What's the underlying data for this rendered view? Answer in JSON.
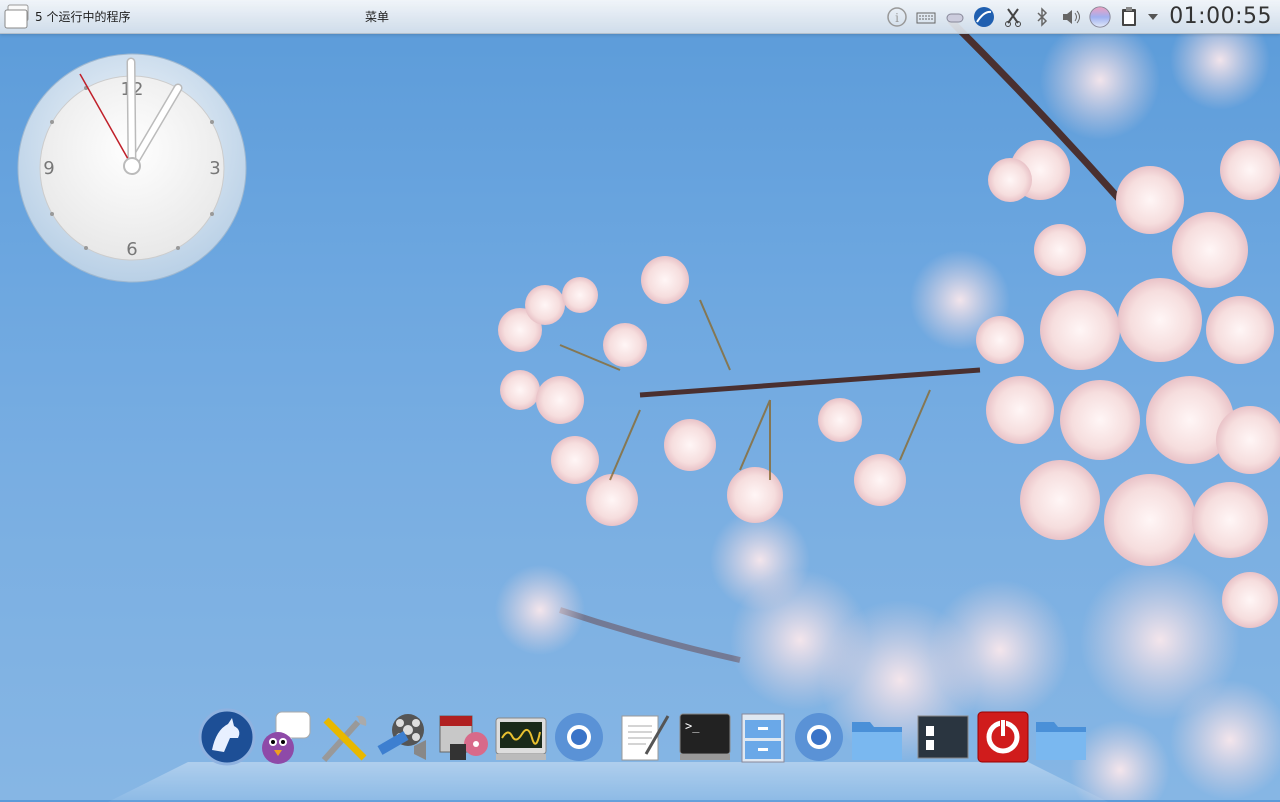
{
  "panel": {
    "running_tasks": "5 个运行中的程序",
    "menu": "菜单",
    "time": "01:00:55"
  },
  "tray_icons": [
    "info-icon",
    "keyboard-icon",
    "network-icon",
    "browser-icon",
    "scissors-icon",
    "bluetooth-icon",
    "volume-icon",
    "color-icon",
    "clipboard-icon",
    "expand-arrow-icon"
  ],
  "clock_widget": {
    "numerals": [
      "12",
      "3",
      "6",
      "9"
    ]
  },
  "dock_items": [
    "konqueror-icon",
    "pidgin-icon",
    "system-settings-icon",
    "media-player-icon",
    "package-installer-icon",
    "system-monitor-icon",
    "chromium-icon",
    "text-editor-icon",
    "terminal-icon",
    "file-cabinet-icon",
    "chromium-icon",
    "folder-icon",
    "display-icon",
    "shutdown-icon",
    "folder-icon"
  ],
  "colors": {
    "sky": "#6da7e0",
    "panel": "#eef2f6",
    "shutdown_red": "#d01c1c"
  }
}
